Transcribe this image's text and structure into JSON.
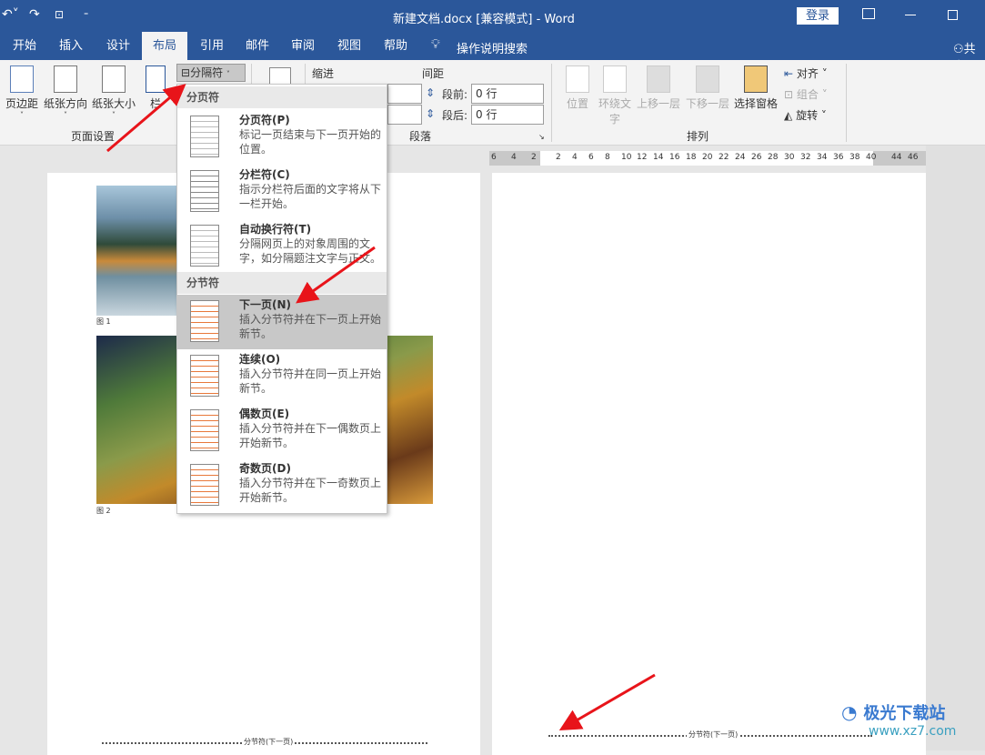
{
  "titlebar": {
    "title": "新建文档.docx [兼容模式]  -  Word",
    "login": "登录",
    "accent": "#2b579a"
  },
  "tabs": [
    "开始",
    "插入",
    "设计",
    "布局",
    "引用",
    "邮件",
    "审阅",
    "视图",
    "帮助"
  ],
  "active_tab": "布局",
  "tell_me": "操作说明搜索",
  "share": "共享",
  "ribbon": {
    "page_setup": {
      "margins": "页边距",
      "orientation": "纸张方向",
      "size": "纸张大小",
      "columns": "栏",
      "breaks": "分隔符",
      "group": "页面设置"
    },
    "paragraph": {
      "indent": "缩进",
      "spacing": "间距",
      "before_label": "段前:",
      "before": "0 行",
      "after_label": "段后:",
      "after": "0 行",
      "group": "段落"
    },
    "arrange": {
      "position": "位置",
      "wrap": "环绕文字",
      "forward": "上移一层",
      "backward": "下移一层",
      "pane": "选择窗格",
      "align": "对齐",
      "group_btn": "组合",
      "rotate": "旋转",
      "group": "排列"
    }
  },
  "ruler": [
    "6",
    "4",
    "2",
    "2",
    "4",
    "6",
    "8",
    "10",
    "12",
    "14",
    "16",
    "18",
    "20",
    "22",
    "24",
    "26",
    "28",
    "30",
    "32",
    "34",
    "36",
    "38",
    "40",
    "44",
    "46"
  ],
  "menu": {
    "page_breaks_header": "分页符",
    "section_breaks_header": "分节符",
    "items": [
      {
        "title": "分页符(P)",
        "desc": "标记一页结束与下一页开始的位置。"
      },
      {
        "title": "分栏符(C)",
        "desc": "指示分栏符后面的文字将从下一栏开始。"
      },
      {
        "title": "自动换行符(T)",
        "desc": "分隔网页上的对象周围的文字，如分隔题注文字与正文。"
      },
      {
        "title": "下一页(N)",
        "desc": "插入分节符并在下一页上开始新节。"
      },
      {
        "title": "连续(O)",
        "desc": "插入分节符并在同一页上开始新节。"
      },
      {
        "title": "偶数页(E)",
        "desc": "插入分节符并在下一偶数页上开始新节。"
      },
      {
        "title": "奇数页(D)",
        "desc": "插入分节符并在下一奇数页上开始新节。"
      }
    ]
  },
  "document": {
    "caption1": "图 1",
    "caption2": "图 2",
    "section_break": "分节符(下一页)"
  },
  "watermark": {
    "name": "极光下载站",
    "url": "www.xz7.com"
  }
}
